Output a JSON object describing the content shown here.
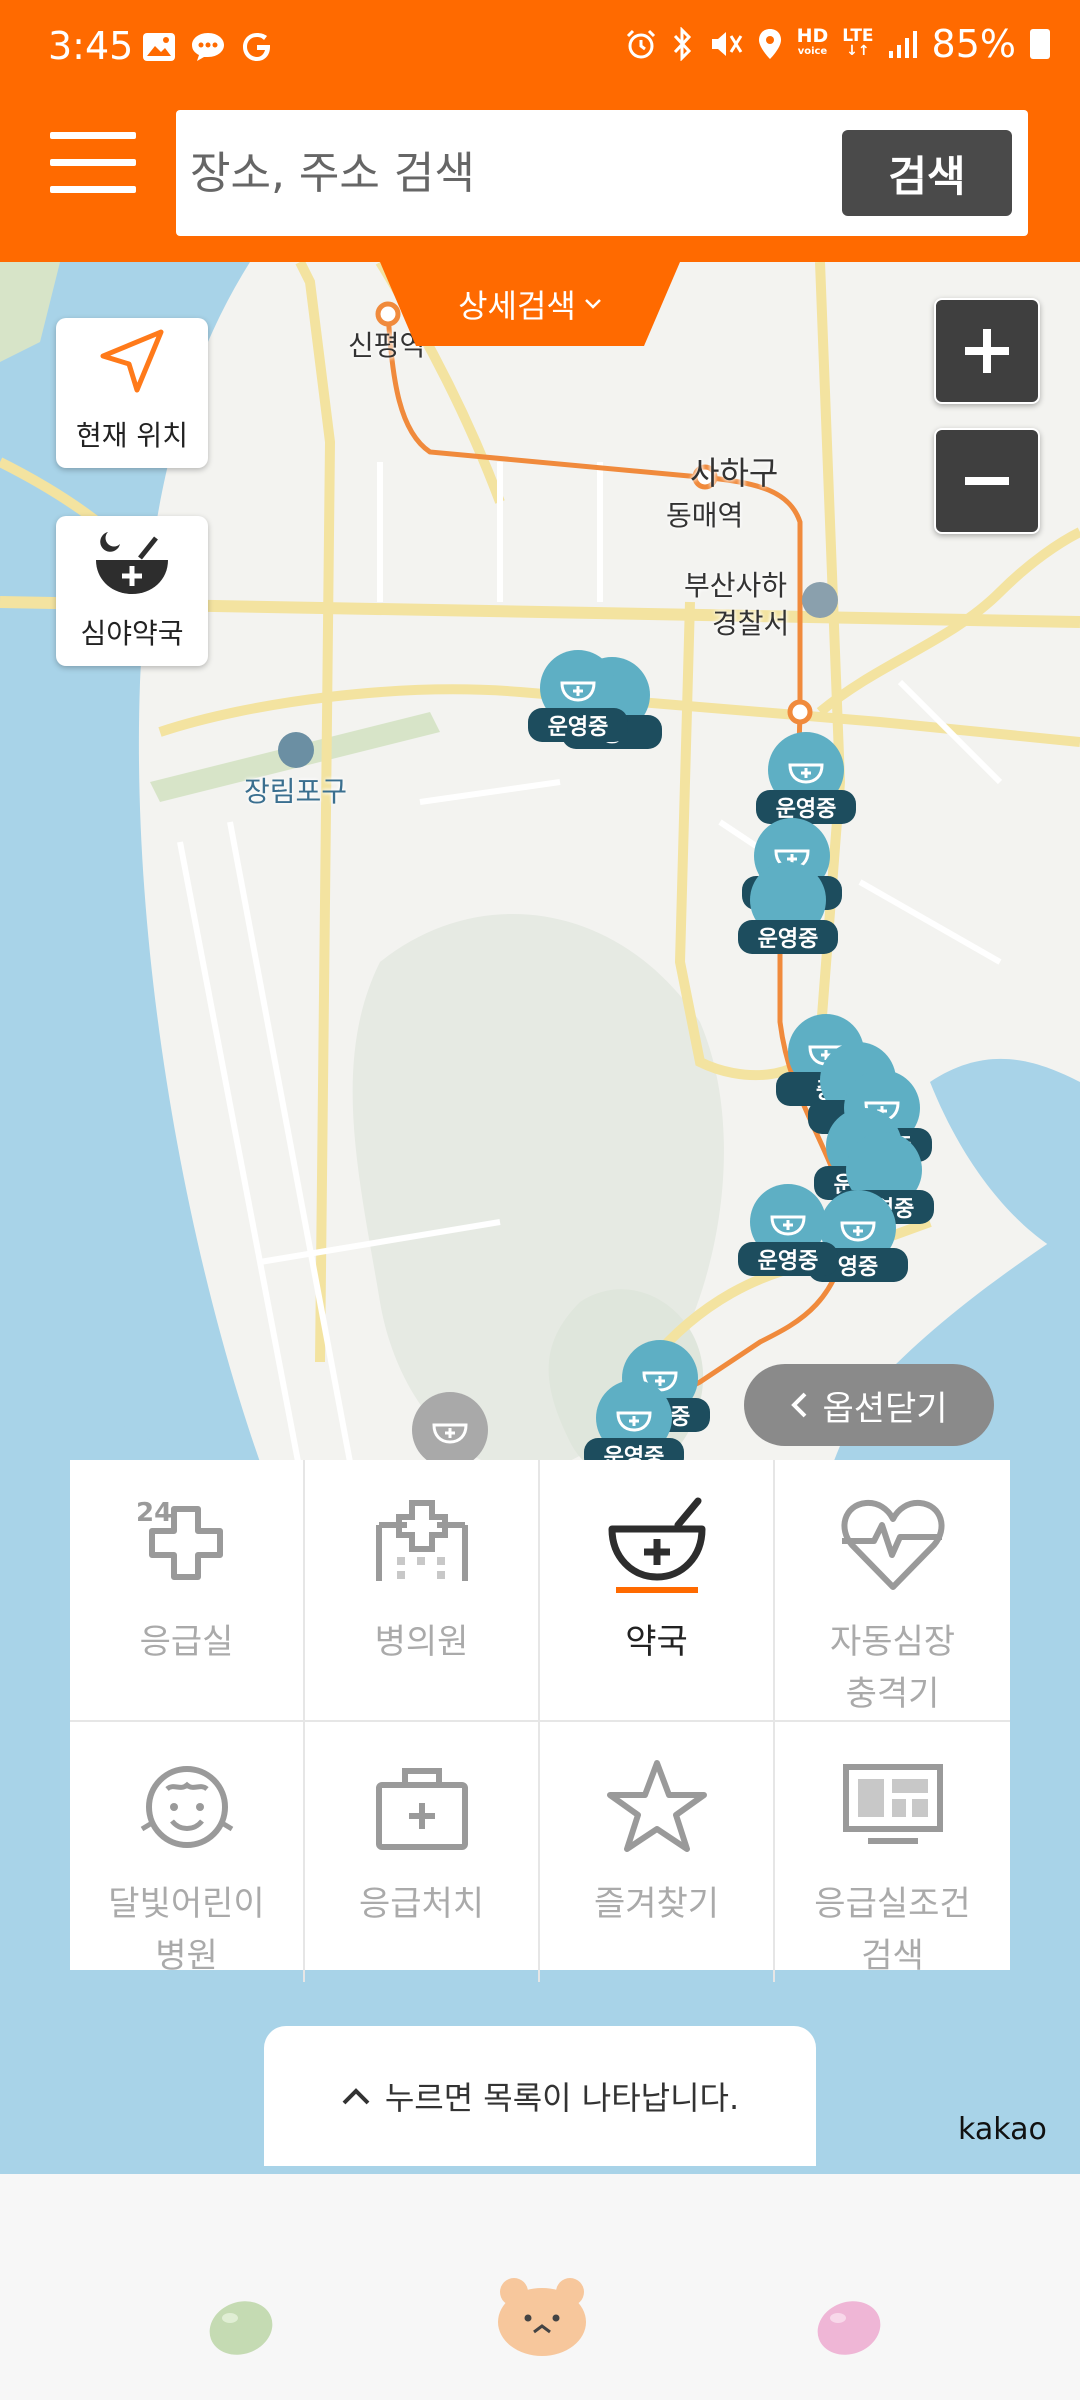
{
  "status_bar": {
    "time": "3:45",
    "hd_voice_top": "HD",
    "hd_voice_bottom": "voice",
    "lte": "LTE",
    "battery": "85%"
  },
  "header": {
    "search_placeholder": "장소, 주소 검색",
    "search_button": "검색",
    "detail_search": "상세검색"
  },
  "map": {
    "side_buttons": {
      "current_location": "현재 위치",
      "night_pharmacy": "심야약국"
    },
    "labels": {
      "sinpyeong": "신평역",
      "saha_gu": "사하구",
      "dongmae": "동매역",
      "police_1": "부산사하",
      "police_2": "경찰서",
      "jangnim_port": "장림포구"
    },
    "marker_status": "운영중",
    "marker_partial": "중",
    "marker_partial_2": "영중",
    "close_options": "옵션닫기"
  },
  "categories": [
    {
      "label": "응급실",
      "icon": "emergency-24-icon"
    },
    {
      "label": "병의원",
      "icon": "hospital-icon"
    },
    {
      "label": "약국",
      "icon": "pharmacy-bowl-icon",
      "active": true
    },
    {
      "label": "자동심장\n충격기",
      "icon": "heart-pulse-icon"
    },
    {
      "label": "달빛어린이\n병원",
      "icon": "child-face-icon"
    },
    {
      "label": "응급처치",
      "icon": "first-aid-kit-icon"
    },
    {
      "label": "즐겨찾기",
      "icon": "star-icon"
    },
    {
      "label": "응급실조건\n검색",
      "icon": "monitor-icon"
    }
  ],
  "list_hint": "누르면 목록이 나타납니다.",
  "map_provider": "kakao",
  "colors": {
    "brand": "#ff6a00",
    "marker": "#5eafc4",
    "marker_tag": "#1d4d5e",
    "water": "#a8d3e8"
  }
}
